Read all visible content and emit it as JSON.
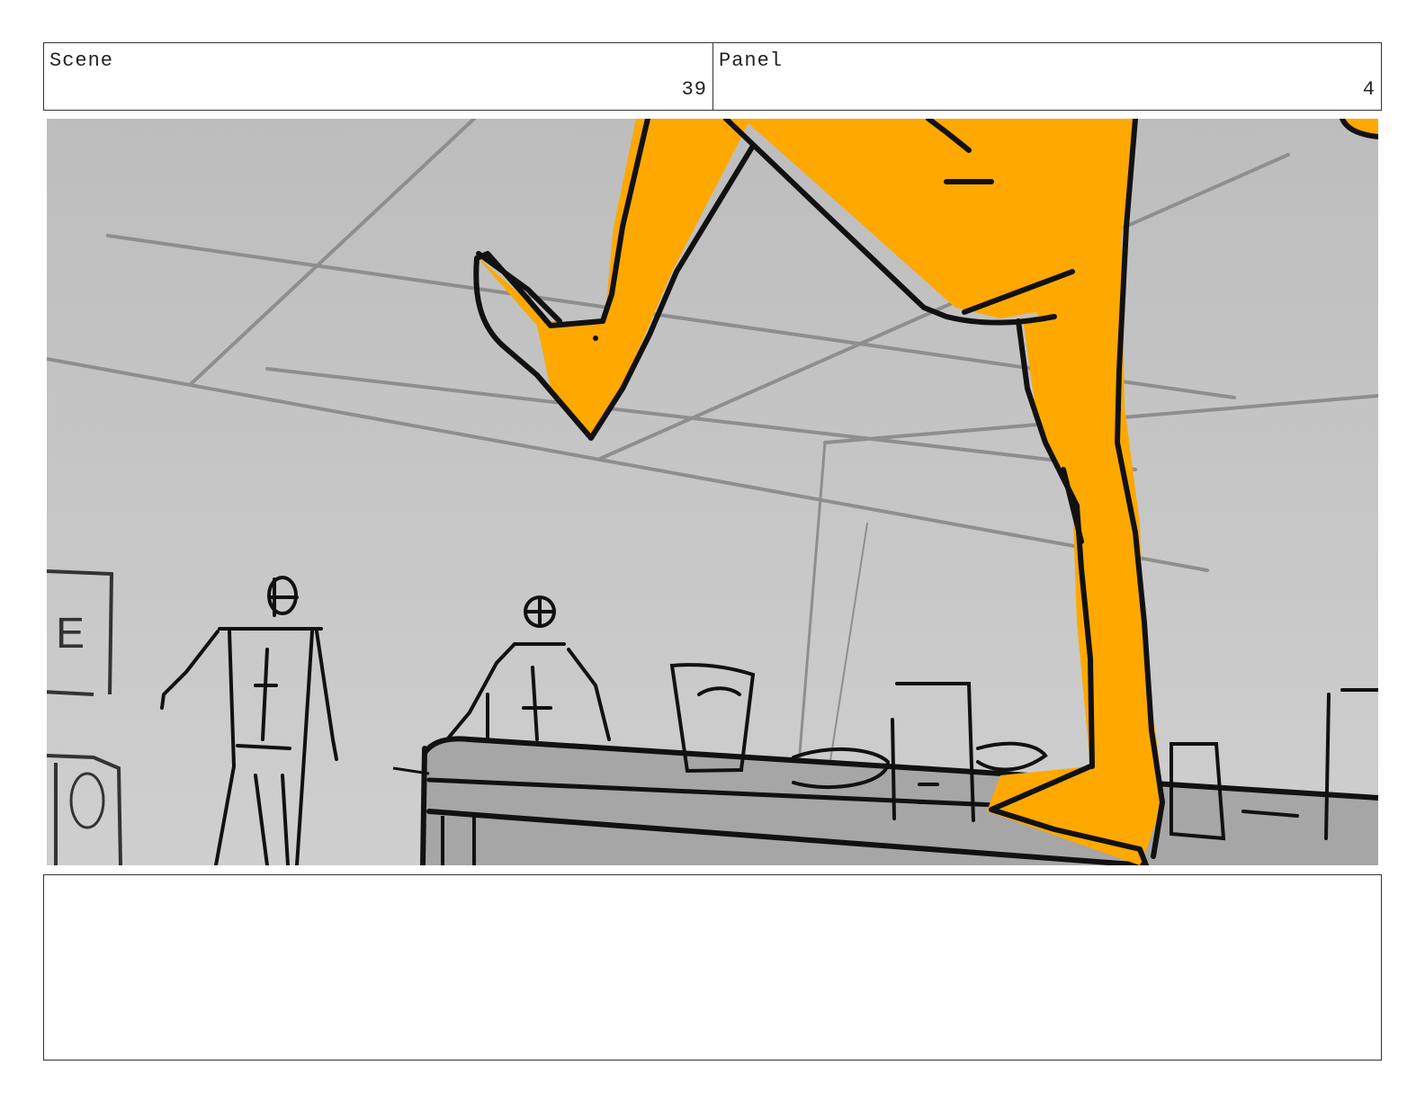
{
  "header": {
    "scene_label": "Scene",
    "scene_value": "39",
    "panel_label": "Panel",
    "panel_value": "4"
  },
  "sketch": {
    "sign_text": "E",
    "colors": {
      "background": "#c4c4c4",
      "character": "#ffa800",
      "ink": "#111111",
      "ceiling_lines": "#8e8e8e",
      "counter": "#a6a6a6"
    }
  },
  "notes": {
    "text": ""
  }
}
